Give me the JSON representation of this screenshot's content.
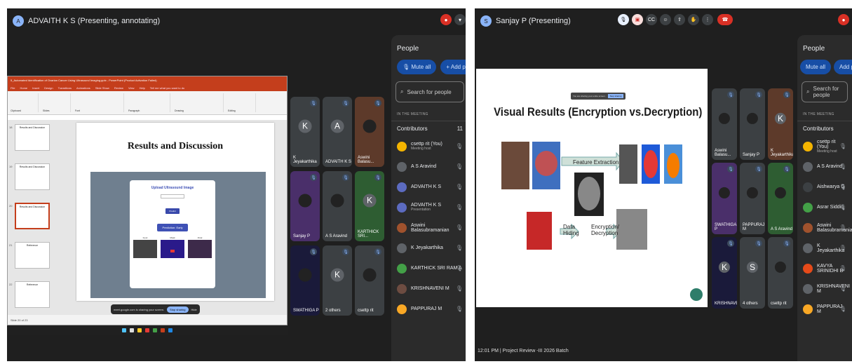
{
  "left": {
    "presenter_label": "ADVAITH K S (Presenting, annotating)",
    "people": {
      "title": "People",
      "mute_all": "Mute all",
      "add_people": "Add people",
      "search_placeholder": "Search for people",
      "in_meeting": "IN THE MEETING",
      "contributors": "Contributors",
      "contributor_count": "11",
      "rows": [
        {
          "name": "csettp rit (You)",
          "sub": "Meeting host",
          "color": "#f4b400"
        },
        {
          "name": "A S Aravind",
          "sub": "",
          "color": "#5f6368"
        },
        {
          "name": "ADVAITH K S",
          "sub": "",
          "color": "#5c6bc0"
        },
        {
          "name": "ADVAITH K S",
          "sub": "Presentation",
          "color": "#5c6bc0"
        },
        {
          "name": "Aswini Balasubramanian",
          "sub": "",
          "color": "#a0522d"
        },
        {
          "name": "K Jeyakarthika",
          "sub": "",
          "color": "#5f6368"
        },
        {
          "name": "KARTHICK SRI RAM A",
          "sub": "",
          "color": "#43a047"
        },
        {
          "name": "KRISHNAVENI M",
          "sub": "",
          "color": "#6d4c41"
        },
        {
          "name": "PAPPURAJ M",
          "sub": "",
          "color": "#f9a825"
        }
      ]
    },
    "tiles": [
      {
        "label": "K Jeyakarthika",
        "initial": "K"
      },
      {
        "label": "ADVAITH K S",
        "initial": "A"
      },
      {
        "label": "Aswini Balasu...",
        "initial": ""
      },
      {
        "label": "Sanjay P",
        "initial": ""
      },
      {
        "label": "A S Aravind",
        "initial": ""
      },
      {
        "label": "KARTHICK SRI...",
        "initial": "K"
      },
      {
        "label": "SWATHIGA P",
        "initial": ""
      },
      {
        "label": "2 others",
        "initial": "K"
      },
      {
        "label": "csettp rit",
        "initial": ""
      }
    ],
    "ppt": {
      "title_bar": "5_Automated Identification of Ovarian Cancer Using Ultrasound Imaging.pptx - PowerPoint (Product Activation Failed)",
      "tabs": [
        "File",
        "Home",
        "Insert",
        "Design",
        "Transitions",
        "Animations",
        "Slide Show",
        "Review",
        "View",
        "Help",
        "Tell me what you want to do"
      ],
      "ribbon_groups": [
        "Clipboard",
        "Slides",
        "Font",
        "Paragraph",
        "Drawing",
        "Editing"
      ],
      "slide_title": "Results and Discussion",
      "thumb_titles": [
        "Results and Discussion",
        "Results and Discussion",
        "Results and Discussion",
        "Reference",
        "Reference"
      ],
      "thumb_numbers": [
        "18",
        "19",
        "20",
        "21",
        "22"
      ],
      "card_title": "Upload Ultrasound Image",
      "card_button": "Predict",
      "card_predict_label": "Prediction: Early",
      "card_captions": [
        "Input",
        "Mask",
        "Final"
      ],
      "status": "Slide 20 of 23",
      "share_text": "meet.google.com is sharing your screen.",
      "share_stop": "Stop sharing",
      "share_hide": "Hide"
    }
  },
  "right": {
    "presenter_label": "Sanjay P (Presenting)",
    "people": {
      "title": "People",
      "mute_all": "Mute all",
      "add_people": "Add people",
      "search_placeholder": "Search for people",
      "in_meeting": "IN THE MEETING",
      "contributors": "Contributors",
      "rows": [
        {
          "name": "csettp rit (You)",
          "sub": "Meeting host",
          "color": "#f4b400"
        },
        {
          "name": "A S Aravind",
          "sub": "",
          "color": "#5f6368"
        },
        {
          "name": "Aishwarya G",
          "sub": "",
          "color": "#3c4043"
        },
        {
          "name": "Asrar Siddiq",
          "sub": "",
          "color": "#43a047"
        },
        {
          "name": "Aswini Balasubramanian",
          "sub": "",
          "color": "#a0522d"
        },
        {
          "name": "K Jeyakarthika",
          "sub": "",
          "color": "#5f6368"
        },
        {
          "name": "KAVYA SRINIDHI B",
          "sub": "",
          "color": "#e64a19"
        },
        {
          "name": "KRISHNAVENI M",
          "sub": "",
          "color": "#5f6368"
        },
        {
          "name": "PAPPURAJ M",
          "sub": "",
          "color": "#f9a825"
        }
      ]
    },
    "tiles": [
      {
        "label": "Aswini Balasu...",
        "initial": ""
      },
      {
        "label": "Sanjay P",
        "initial": ""
      },
      {
        "label": "K Jeyakarthika",
        "initial": "K"
      },
      {
        "label": "SWATHIGA P",
        "initial": ""
      },
      {
        "label": "PAPPURAJ M",
        "initial": ""
      },
      {
        "label": "A S Aravind",
        "initial": ""
      },
      {
        "label": "KRISHNAVENI...",
        "initial": "K"
      },
      {
        "label": "4 others",
        "initial": "S"
      },
      {
        "label": "csettp rit",
        "initial": ""
      }
    ],
    "slide": {
      "title": "Visual Results (Encryption vs.Decryption)",
      "chip_text": "You are sharing your entire screen.",
      "chip_stop": "Stop sharing",
      "feature_extraction": "Feature Extraction",
      "data_hiding": "Data\nHiding",
      "enc_dec": "Encryption/\nDecryption"
    },
    "footer": "12:01 PM | Project Review -III 2026 Batch"
  }
}
